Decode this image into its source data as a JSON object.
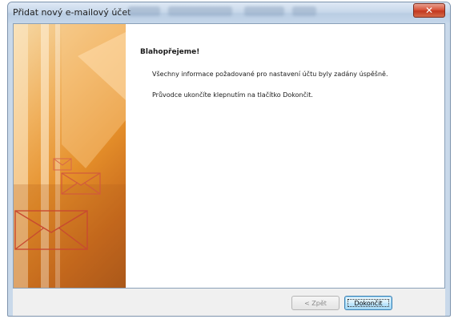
{
  "window": {
    "title": "Přidat nový e-mailový účet",
    "close_glyph": "✕"
  },
  "content": {
    "heading": "Blahopřejeme!",
    "line1": "Všechny informace požadované pro nastavení účtu byly zadány úspěšně.",
    "line2": "Průvodce ukončíte klepnutím na tlačítko Dokončit."
  },
  "buttons": {
    "back": "< Zpět",
    "finish": "Dokončit"
  },
  "colors": {
    "art_orange": "#e58f2a",
    "finish_border": "#3c7fb1"
  }
}
